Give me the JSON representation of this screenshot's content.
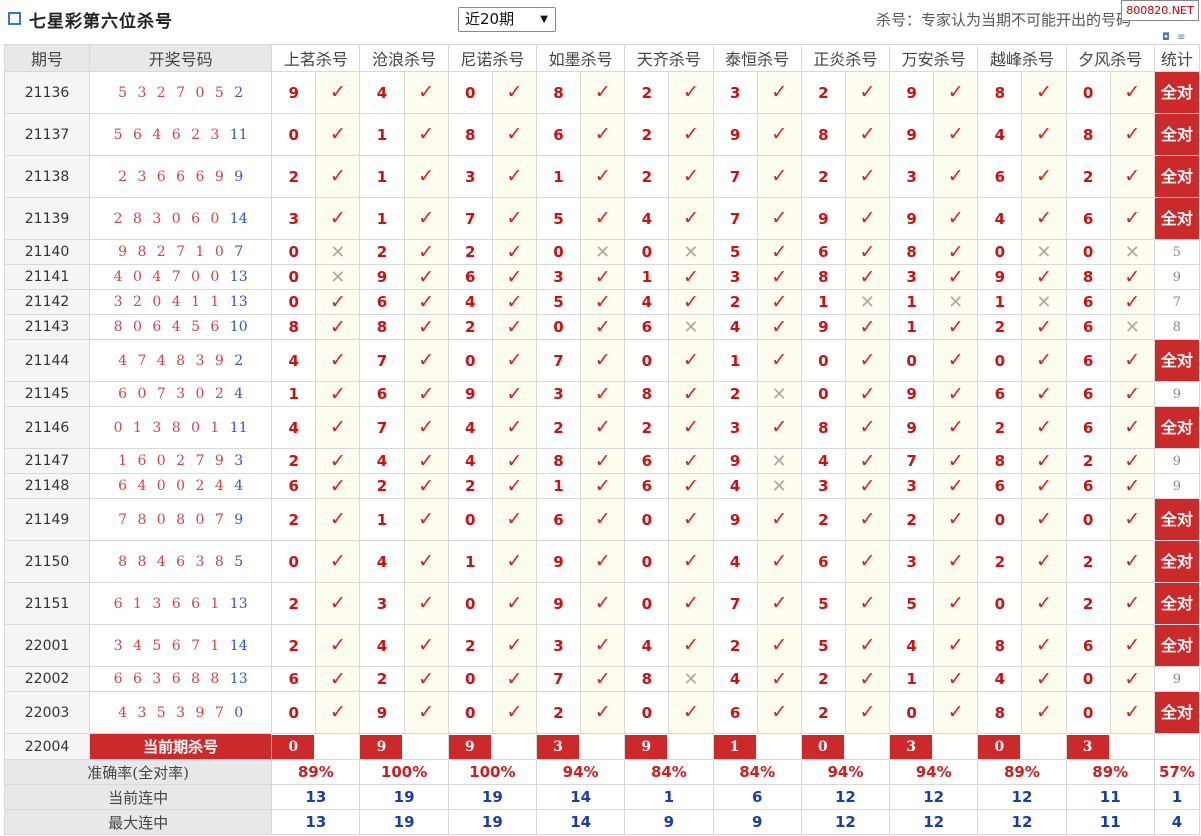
{
  "header": {
    "title": "七星彩第六位杀号",
    "period_select": "近20期",
    "note": "杀号：专家认为当期不可能开出的号码",
    "badge": "800820.NET"
  },
  "table": {
    "col_period": "期号",
    "col_numbers": "开奖号码",
    "col_stats": "统计",
    "experts": [
      "上茗杀号",
      "沧浪杀号",
      "尼诺杀号",
      "如墨杀号",
      "天齐杀号",
      "泰恒杀号",
      "正炎杀号",
      "万安杀号",
      "越峰杀号",
      "夕风杀号"
    ],
    "full_label": "全对",
    "check_glyph": "✓",
    "cross_glyph": "✕",
    "rows": [
      {
        "period": "21136",
        "nums": "5 3 2 7 0 5",
        "blue": "2",
        "kills": [
          "9",
          "4",
          "0",
          "8",
          "2",
          "3",
          "2",
          "9",
          "8",
          "0"
        ],
        "ok": [
          1,
          1,
          1,
          1,
          1,
          1,
          1,
          1,
          1,
          1
        ],
        "stat": "全对",
        "tall": true
      },
      {
        "period": "21137",
        "nums": "5 6 4 6 2 3",
        "blue": "11",
        "kills": [
          "0",
          "1",
          "8",
          "6",
          "2",
          "9",
          "8",
          "9",
          "4",
          "8"
        ],
        "ok": [
          1,
          1,
          1,
          1,
          1,
          1,
          1,
          1,
          1,
          1
        ],
        "stat": "全对",
        "tall": true
      },
      {
        "period": "21138",
        "nums": "2 3 6 6 6 9",
        "blue": "9",
        "kills": [
          "2",
          "1",
          "3",
          "1",
          "2",
          "7",
          "2",
          "3",
          "6",
          "2"
        ],
        "ok": [
          1,
          1,
          1,
          1,
          1,
          1,
          1,
          1,
          1,
          1
        ],
        "stat": "全对",
        "tall": true
      },
      {
        "period": "21139",
        "nums": "2 8 3 0 6 0",
        "blue": "14",
        "kills": [
          "3",
          "1",
          "7",
          "5",
          "4",
          "7",
          "9",
          "9",
          "4",
          "6"
        ],
        "ok": [
          1,
          1,
          1,
          1,
          1,
          1,
          1,
          1,
          1,
          1
        ],
        "stat": "全对",
        "tall": true
      },
      {
        "period": "21140",
        "nums": "9 8 2 7 1 0",
        "blue": "7",
        "kills": [
          "0",
          "2",
          "2",
          "0",
          "0",
          "5",
          "6",
          "8",
          "0",
          "0"
        ],
        "ok": [
          0,
          1,
          1,
          0,
          0,
          1,
          1,
          1,
          0,
          0
        ],
        "stat": "5",
        "tall": false
      },
      {
        "period": "21141",
        "nums": "4 0 4 7 0 0",
        "blue": "13",
        "kills": [
          "0",
          "9",
          "6",
          "3",
          "1",
          "3",
          "8",
          "3",
          "9",
          "8"
        ],
        "ok": [
          0,
          1,
          1,
          1,
          1,
          1,
          1,
          1,
          1,
          1
        ],
        "stat": "9",
        "tall": false
      },
      {
        "period": "21142",
        "nums": "3 2 0 4 1 1",
        "blue": "13",
        "kills": [
          "0",
          "6",
          "4",
          "5",
          "4",
          "2",
          "1",
          "1",
          "1",
          "6"
        ],
        "ok": [
          1,
          1,
          1,
          1,
          1,
          1,
          0,
          0,
          0,
          1
        ],
        "stat": "7",
        "tall": false
      },
      {
        "period": "21143",
        "nums": "8 0 6 4 5 6",
        "blue": "10",
        "kills": [
          "8",
          "8",
          "2",
          "0",
          "6",
          "4",
          "9",
          "1",
          "2",
          "6"
        ],
        "ok": [
          1,
          1,
          1,
          1,
          0,
          1,
          1,
          1,
          1,
          0
        ],
        "stat": "8",
        "tall": false
      },
      {
        "period": "21144",
        "nums": "4 7 4 8 3 9",
        "blue": "2",
        "kills": [
          "4",
          "7",
          "0",
          "7",
          "0",
          "1",
          "0",
          "0",
          "0",
          "6"
        ],
        "ok": [
          1,
          1,
          1,
          1,
          1,
          1,
          1,
          1,
          1,
          1
        ],
        "stat": "全对",
        "tall": true
      },
      {
        "period": "21145",
        "nums": "6 0 7 3 0 2",
        "blue": "4",
        "kills": [
          "1",
          "6",
          "9",
          "3",
          "8",
          "2",
          "0",
          "9",
          "6",
          "6"
        ],
        "ok": [
          1,
          1,
          1,
          1,
          1,
          0,
          1,
          1,
          1,
          1
        ],
        "stat": "9",
        "tall": false
      },
      {
        "period": "21146",
        "nums": "0 1 3 8 0 1",
        "blue": "11",
        "kills": [
          "4",
          "7",
          "4",
          "2",
          "2",
          "3",
          "8",
          "9",
          "2",
          "6"
        ],
        "ok": [
          1,
          1,
          1,
          1,
          1,
          1,
          1,
          1,
          1,
          1
        ],
        "stat": "全对",
        "tall": true
      },
      {
        "period": "21147",
        "nums": "1 6 0 2 7 9",
        "blue": "3",
        "kills": [
          "2",
          "4",
          "4",
          "8",
          "6",
          "9",
          "4",
          "7",
          "8",
          "2"
        ],
        "ok": [
          1,
          1,
          1,
          1,
          1,
          0,
          1,
          1,
          1,
          1
        ],
        "stat": "9",
        "tall": false
      },
      {
        "period": "21148",
        "nums": "6 4 0 0 2 4",
        "blue": "4",
        "kills": [
          "6",
          "2",
          "2",
          "1",
          "6",
          "4",
          "3",
          "3",
          "6",
          "6"
        ],
        "ok": [
          1,
          1,
          1,
          1,
          1,
          0,
          1,
          1,
          1,
          1
        ],
        "stat": "9",
        "tall": false
      },
      {
        "period": "21149",
        "nums": "7 8 0 8 0 7",
        "blue": "9",
        "kills": [
          "2",
          "1",
          "0",
          "6",
          "0",
          "9",
          "2",
          "2",
          "0",
          "0"
        ],
        "ok": [
          1,
          1,
          1,
          1,
          1,
          1,
          1,
          1,
          1,
          1
        ],
        "stat": "全对",
        "tall": true
      },
      {
        "period": "21150",
        "nums": "8 8 4 6 3 8",
        "blue": "5",
        "kills": [
          "0",
          "4",
          "1",
          "9",
          "0",
          "4",
          "6",
          "3",
          "2",
          "2"
        ],
        "ok": [
          1,
          1,
          1,
          1,
          1,
          1,
          1,
          1,
          1,
          1
        ],
        "stat": "全对",
        "tall": true
      },
      {
        "period": "21151",
        "nums": "6 1 3 6 6 1",
        "blue": "13",
        "kills": [
          "2",
          "3",
          "0",
          "9",
          "0",
          "7",
          "5",
          "5",
          "0",
          "2"
        ],
        "ok": [
          1,
          1,
          1,
          1,
          1,
          1,
          1,
          1,
          1,
          1
        ],
        "stat": "全对",
        "tall": true
      },
      {
        "period": "22001",
        "nums": "3 4 5 6 7 1",
        "blue": "14",
        "kills": [
          "2",
          "4",
          "2",
          "3",
          "4",
          "2",
          "5",
          "4",
          "8",
          "6"
        ],
        "ok": [
          1,
          1,
          1,
          1,
          1,
          1,
          1,
          1,
          1,
          1
        ],
        "stat": "全对",
        "tall": true
      },
      {
        "period": "22002",
        "nums": "6 6 3 6 8 8",
        "blue": "13",
        "kills": [
          "6",
          "2",
          "0",
          "7",
          "8",
          "4",
          "2",
          "1",
          "4",
          "0"
        ],
        "ok": [
          1,
          1,
          1,
          1,
          0,
          1,
          1,
          1,
          1,
          1
        ],
        "stat": "9",
        "tall": false
      },
      {
        "period": "22003",
        "nums": "4 3 5 3 9 7",
        "blue": "0",
        "kills": [
          "0",
          "9",
          "0",
          "2",
          "0",
          "6",
          "2",
          "0",
          "8",
          "0"
        ],
        "ok": [
          1,
          1,
          1,
          1,
          1,
          1,
          1,
          1,
          1,
          1
        ],
        "stat": "全对",
        "tall": true
      }
    ],
    "current": {
      "period": "22004",
      "label": "当前期杀号",
      "kills": [
        "0",
        "9",
        "9",
        "3",
        "9",
        "1",
        "0",
        "3",
        "0",
        "3"
      ]
    },
    "footer": [
      {
        "label": "准确率(全对率)",
        "kind": "rate",
        "values": [
          "89%",
          "100%",
          "100%",
          "94%",
          "84%",
          "84%",
          "94%",
          "94%",
          "89%",
          "89%"
        ],
        "stat": "57%"
      },
      {
        "label": "当前连中",
        "kind": "blue",
        "values": [
          "13",
          "19",
          "19",
          "14",
          "1",
          "6",
          "12",
          "12",
          "12",
          "11"
        ],
        "stat": "1"
      },
      {
        "label": "最大连中",
        "kind": "blue",
        "values": [
          "13",
          "19",
          "19",
          "14",
          "9",
          "9",
          "12",
          "12",
          "12",
          "11"
        ],
        "stat": "4"
      }
    ]
  }
}
